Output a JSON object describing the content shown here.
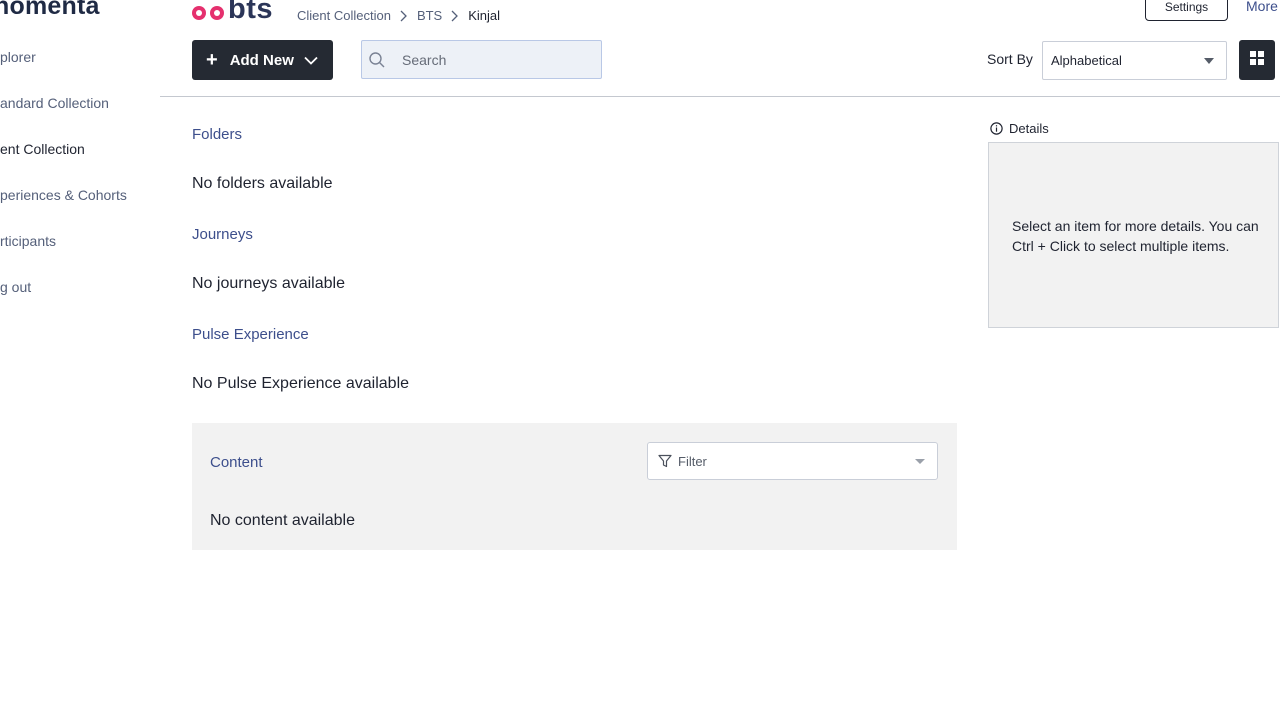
{
  "sidebar": {
    "brand": "nomenta",
    "items": [
      {
        "label": "plorer"
      },
      {
        "label": "andard Collection"
      },
      {
        "label": "ent Collection"
      },
      {
        "label": "periences & Cohorts"
      },
      {
        "label": "rticipants"
      },
      {
        "label": "g out"
      }
    ]
  },
  "header": {
    "logo_text": "bts",
    "breadcrumb": [
      "Client Collection",
      "BTS",
      "Kinjal"
    ],
    "settings_label": "Settings",
    "more_label": "More"
  },
  "toolbar": {
    "add_new_label": "Add New",
    "search_placeholder": "Search",
    "sort_label": "Sort By",
    "sort_value": "Alphabetical"
  },
  "sections": {
    "folders": {
      "title": "Folders",
      "empty": "No folders available"
    },
    "journeys": {
      "title": "Journeys",
      "empty": "No journeys available"
    },
    "pulse": {
      "title": "Pulse Experience",
      "empty": "No Pulse Experience available"
    },
    "content": {
      "title": "Content",
      "empty": "No content available",
      "filter_placeholder": "Filter"
    }
  },
  "details": {
    "title": "Details",
    "message": "Select an item for more details. You can Ctrl + Click to select multiple items."
  },
  "colors": {
    "accent_pink": "#e5306e",
    "dark_button": "#252a33",
    "section_title": "#3d4f8c"
  }
}
